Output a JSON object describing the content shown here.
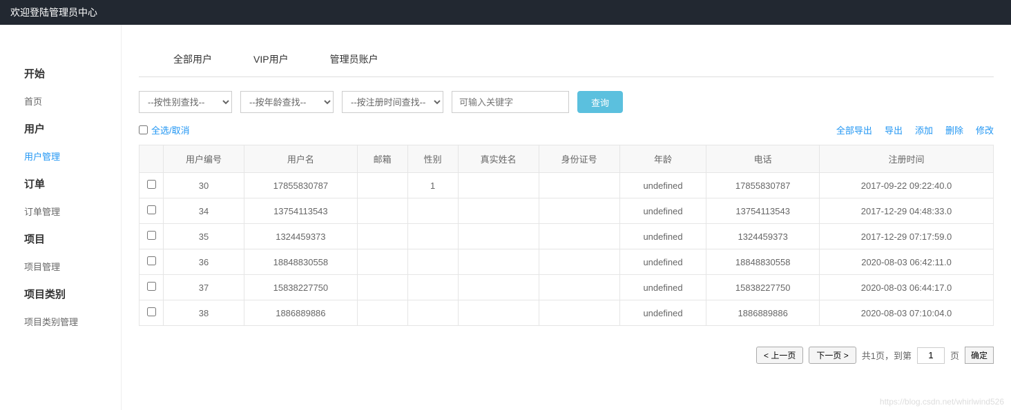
{
  "header": {
    "title": "欢迎登陆管理员中心"
  },
  "sidebar": {
    "sections": [
      {
        "title": "开始",
        "items": [
          {
            "label": "首页",
            "active": false
          }
        ]
      },
      {
        "title": "用户",
        "items": [
          {
            "label": "用户管理",
            "active": true
          }
        ]
      },
      {
        "title": "订单",
        "items": [
          {
            "label": "订单管理",
            "active": false
          }
        ]
      },
      {
        "title": "项目",
        "items": [
          {
            "label": "项目管理",
            "active": false
          }
        ]
      },
      {
        "title": "项目类别",
        "items": [
          {
            "label": "项目类别管理",
            "active": false
          }
        ]
      }
    ]
  },
  "tabs": [
    {
      "label": "全部用户"
    },
    {
      "label": "VIP用户"
    },
    {
      "label": "管理员账户"
    }
  ],
  "filters": {
    "gender": "--按性别查找--",
    "age": "--按年龄查找--",
    "regtime": "--按注册时间查找--",
    "keyword_placeholder": "可输入关键字",
    "search_label": "查询"
  },
  "actions": {
    "select_all": "全选/取消",
    "links": [
      "全部导出",
      "导出",
      "添加",
      "删除",
      "修改"
    ]
  },
  "table": {
    "headers": [
      "",
      "用户编号",
      "用户名",
      "邮箱",
      "性别",
      "真实姓名",
      "身份证号",
      "年龄",
      "电话",
      "注册时间"
    ],
    "rows": [
      {
        "id": "30",
        "username": "17855830787",
        "email": "",
        "gender": "1",
        "realname": "",
        "idcard": "",
        "age": "undefined",
        "phone": "17855830787",
        "regtime": "2017-09-22 09:22:40.0"
      },
      {
        "id": "34",
        "username": "13754113543",
        "email": "",
        "gender": "",
        "realname": "",
        "idcard": "",
        "age": "undefined",
        "phone": "13754113543",
        "regtime": "2017-12-29 04:48:33.0"
      },
      {
        "id": "35",
        "username": "1324459373",
        "email": "",
        "gender": "",
        "realname": "",
        "idcard": "",
        "age": "undefined",
        "phone": "1324459373",
        "regtime": "2017-12-29 07:17:59.0"
      },
      {
        "id": "36",
        "username": "18848830558",
        "email": "",
        "gender": "",
        "realname": "",
        "idcard": "",
        "age": "undefined",
        "phone": "18848830558",
        "regtime": "2020-08-03 06:42:11.0"
      },
      {
        "id": "37",
        "username": "15838227750",
        "email": "",
        "gender": "",
        "realname": "",
        "idcard": "",
        "age": "undefined",
        "phone": "15838227750",
        "regtime": "2020-08-03 06:44:17.0"
      },
      {
        "id": "38",
        "username": "1886889886",
        "email": "",
        "gender": "",
        "realname": "",
        "idcard": "",
        "age": "undefined",
        "phone": "1886889886",
        "regtime": "2020-08-03 07:10:04.0"
      }
    ]
  },
  "pagination": {
    "prev": "< 上一页",
    "next": "下一页 >",
    "total_prefix": "共1页，到第",
    "page_value": "1",
    "page_suffix": "页",
    "confirm": "确定"
  },
  "watermark": "https://blog.csdn.net/whirlwind526"
}
